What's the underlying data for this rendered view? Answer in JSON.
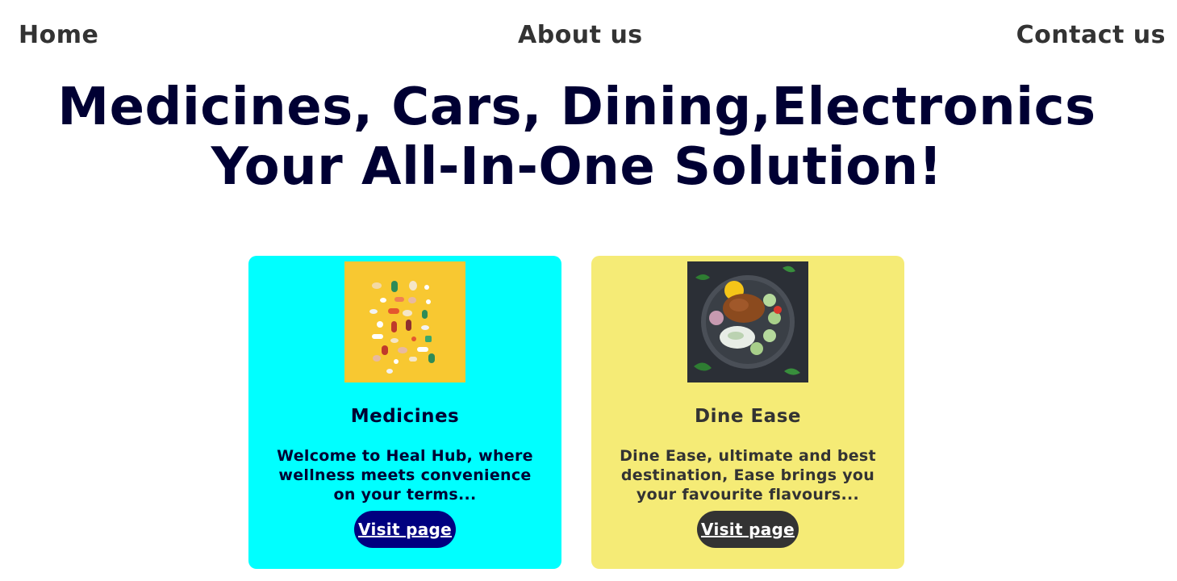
{
  "nav": {
    "home_label": "Home",
    "about_label": "About us",
    "contact_label": "Contact us"
  },
  "headline": {
    "line1": "Medicines, Cars, Dining,Electronics",
    "line2": "Your All-In-One Solution!"
  },
  "cards": [
    {
      "title": "Medicines",
      "description": "Welcome to Heal Hub, where wellness meets convenience on your terms...",
      "button_label": "Visit page",
      "bg_color": "#00FFFF",
      "text_color": "#000033",
      "image": "pills-icon"
    },
    {
      "title": "Dine Ease",
      "description": "Dine Ease, ultimate and best destination, Ease brings you your favourite flavours...",
      "button_label": "Visit page",
      "bg_color": "#F5EB76",
      "text_color": "#333333",
      "image": "food-bowl-icon"
    }
  ],
  "colors": {
    "headline": "#000033",
    "nav": "#333333",
    "med_button": "#000080",
    "dine_button": "#333333"
  }
}
